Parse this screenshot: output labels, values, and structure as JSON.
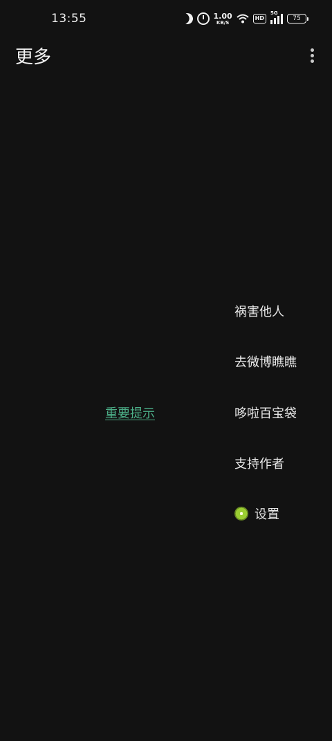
{
  "status_bar": {
    "time": "13:55",
    "network_speed_value": "1.00",
    "network_speed_unit": "KB/S",
    "hd_label": "HD",
    "signal_label": "5G",
    "battery_level": "75"
  },
  "app_bar": {
    "title": "更多",
    "more_icon": "more-vertical-icon"
  },
  "main": {
    "notice_link": "重要提示",
    "menu": [
      {
        "label": "祸害他人"
      },
      {
        "label": "去微博瞧瞧"
      },
      {
        "label": "哆啦百宝袋"
      },
      {
        "label": "支持作者"
      },
      {
        "label": "设置",
        "icon": "kiwi-icon"
      }
    ]
  },
  "colors": {
    "background": "#121212",
    "text": "#E8E8E8",
    "link": "#4CAF88"
  }
}
